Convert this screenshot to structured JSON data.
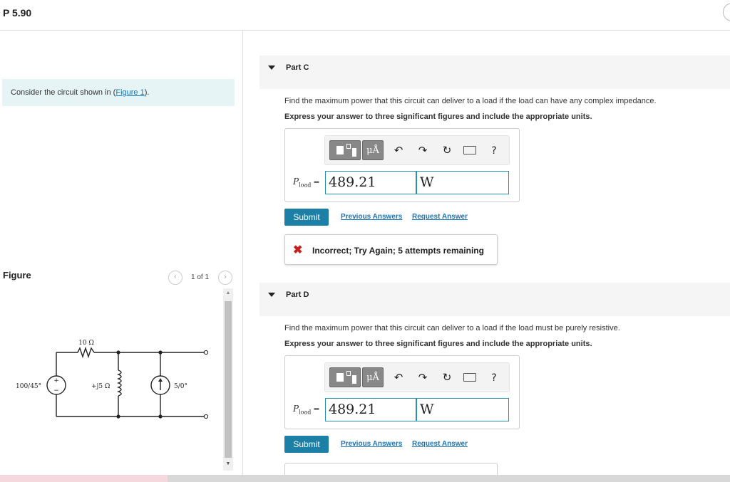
{
  "header": {
    "problem_title": "P 5.90"
  },
  "intro": {
    "text_before": "Consider the circuit shown in (",
    "figure_link": "Figure 1",
    "text_after": ")."
  },
  "figure": {
    "label": "Figure",
    "page_indicator": "1 of 1",
    "circuit_labels": {
      "resistor": "10 Ω",
      "source_voltage": "100/45°",
      "inductor": "+j5 Ω",
      "current_source": "5/0°"
    }
  },
  "parts": [
    {
      "title": "Part C",
      "question": "Find the maximum power that this circuit can deliver to a load if the load can have any complex impedance.",
      "instruction": "Express your answer to three significant figures and include the appropriate units.",
      "variable": "P",
      "variable_sub": "load",
      "equals": "=",
      "value": "489.21",
      "unit": "W",
      "submit_label": "Submit",
      "previous_answers_label": "Previous Answers",
      "request_answer_label": "Request Answer",
      "feedback": "Incorrect; Try Again; 5 attempts remaining"
    },
    {
      "title": "Part D",
      "question": "Find the maximum power that this circuit can deliver to a load if the load must be purely resistive.",
      "instruction": "Express your answer to three significant figures and include the appropriate units.",
      "variable": "P",
      "variable_sub": "load",
      "equals": "=",
      "value": "489.21",
      "unit": "W",
      "submit_label": "Submit",
      "previous_answers_label": "Previous Answers",
      "request_answer_label": "Request Answer"
    }
  ],
  "toolbar": {
    "units_label": "μÅ",
    "undo_icon": "↶",
    "redo_icon": "↷",
    "reset_icon": "↻",
    "keyboard_icon": "⌨",
    "help_label": "?"
  },
  "icons": {
    "nav_prev": "‹",
    "nav_next": "›",
    "scroll_up": "▲",
    "scroll_down": "▼",
    "incorrect": "✖"
  },
  "colors": {
    "accent": "#1b7fa6",
    "link": "#1a73b5",
    "intro_background": "#e6f4f5",
    "error": "#c8201c"
  }
}
